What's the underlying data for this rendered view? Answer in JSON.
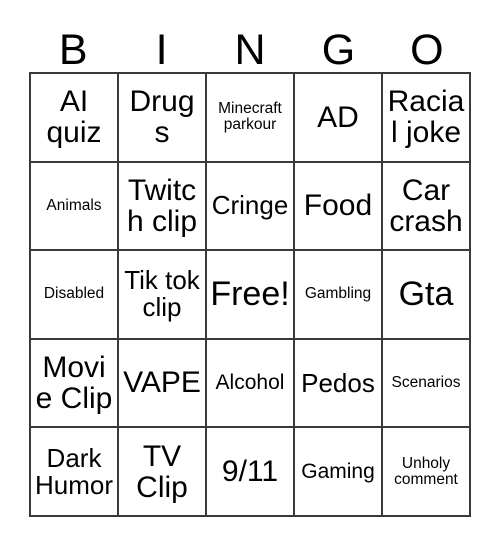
{
  "card": {
    "title_letters": [
      "B",
      "I",
      "N",
      "G",
      "O"
    ],
    "free_space_label": "Free!",
    "colors": {
      "background": "#ffffff",
      "border": "#3a3a3a",
      "text": "#000000"
    },
    "columns": 5,
    "rows": 5,
    "cells": [
      [
        {
          "label": "AI quiz",
          "size": "lg"
        },
        {
          "label": "Drugs",
          "size": "lg"
        },
        {
          "label": "Minecraft parkour",
          "size": "xs"
        },
        {
          "label": "AD",
          "size": "lg"
        },
        {
          "label": "Racial joke",
          "size": "lg"
        }
      ],
      [
        {
          "label": "Animals",
          "size": "xs"
        },
        {
          "label": "Twitch clip",
          "size": "lg"
        },
        {
          "label": "Cringe",
          "size": "md"
        },
        {
          "label": "Food",
          "size": "lg"
        },
        {
          "label": "Car crash",
          "size": "lg"
        }
      ],
      [
        {
          "label": "Disabled",
          "size": "xs"
        },
        {
          "label": "Tik tok clip",
          "size": "md"
        },
        {
          "label": "Free!",
          "size": "xl"
        },
        {
          "label": "Gambling",
          "size": "xs"
        },
        {
          "label": "Gta",
          "size": "xl"
        }
      ],
      [
        {
          "label": "Movie Clip",
          "size": "lg"
        },
        {
          "label": "VAPE",
          "size": "lg"
        },
        {
          "label": "Alcohol",
          "size": "sm"
        },
        {
          "label": "Pedos",
          "size": "md"
        },
        {
          "label": "Scenarios",
          "size": "xs"
        }
      ],
      [
        {
          "label": "Dark Humor",
          "size": "md"
        },
        {
          "label": "TV Clip",
          "size": "lg"
        },
        {
          "label": "9/11",
          "size": "lg"
        },
        {
          "label": "Gaming",
          "size": "sm"
        },
        {
          "label": "Unholy comment",
          "size": "xs"
        }
      ]
    ]
  }
}
